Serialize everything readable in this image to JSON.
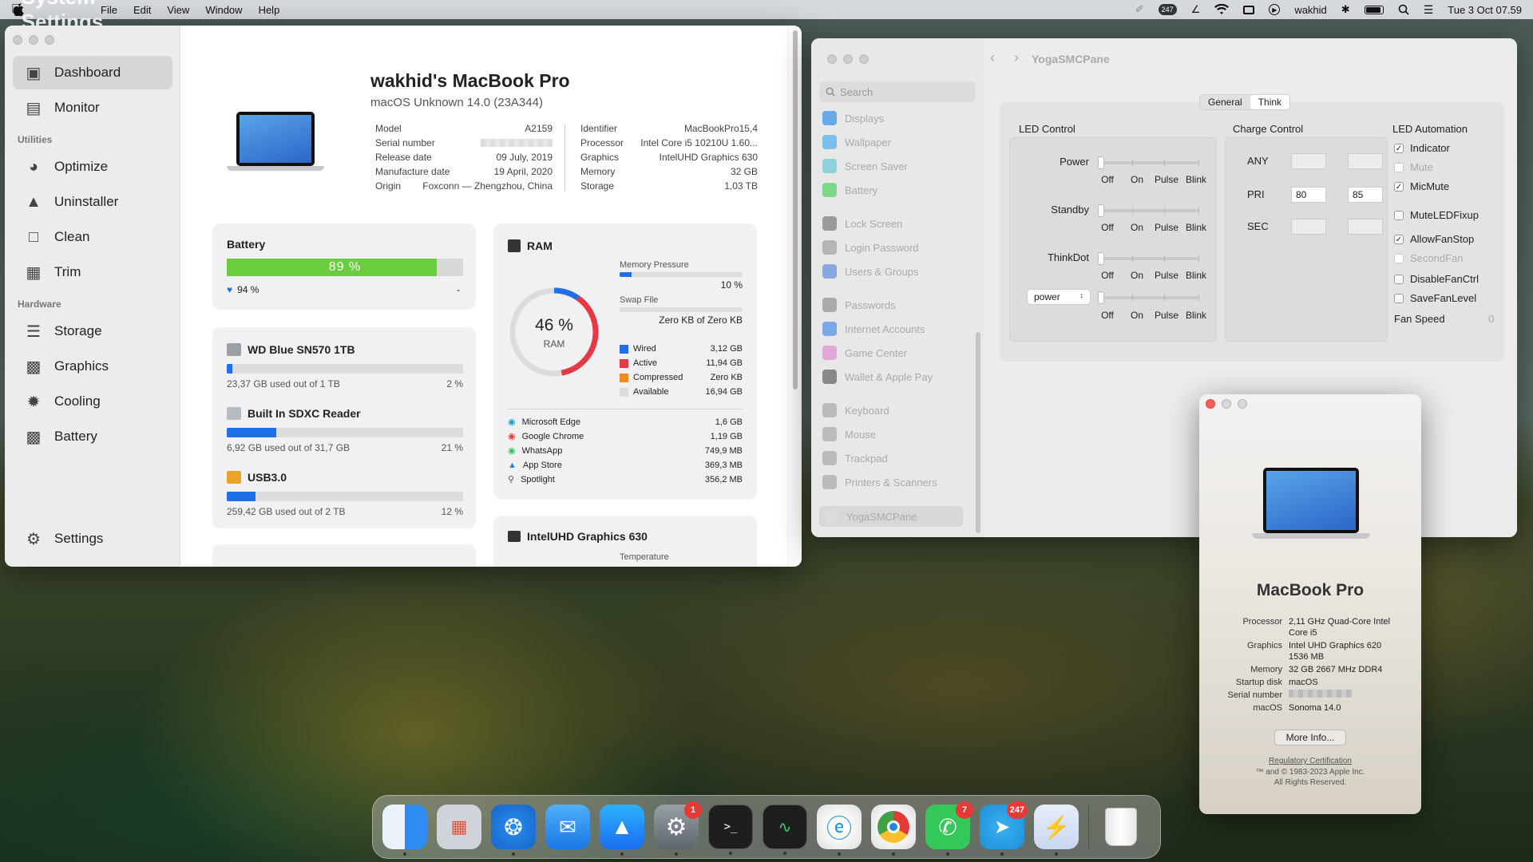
{
  "menubar": {
    "app": "System Settings",
    "items": [
      "File",
      "Edit",
      "View",
      "Window",
      "Help"
    ],
    "user": "wakhid",
    "clock": "Tue 3 Oct  07.59",
    "badge_247": "247"
  },
  "sidebar": {
    "items": [
      "Dashboard",
      "Monitor",
      "Optimize",
      "Uninstaller",
      "Clean",
      "Trim",
      "Storage",
      "Graphics",
      "Cooling",
      "Battery",
      "Settings"
    ],
    "utilities": "Utilities",
    "hardware": "Hardware"
  },
  "machine": {
    "name": "wakhid's MacBook Pro",
    "os": "macOS Unknown 14.0 (23A344)",
    "specs_left": [
      [
        "Model",
        "A2159"
      ],
      [
        "Serial number",
        ""
      ],
      [
        "Release date",
        "09 July, 2019"
      ],
      [
        "Manufacture date",
        "19 April, 2020"
      ],
      [
        "Origin",
        "Foxconn — Zhengzhou, China"
      ]
    ],
    "specs_right": [
      [
        "Identifier",
        "MacBookPro15,4"
      ],
      [
        "Processor",
        "Intel Core i5 10210U 1.60..."
      ],
      [
        "Graphics",
        "IntelUHD Graphics 630"
      ],
      [
        "Memory",
        "32 GB"
      ],
      [
        "Storage",
        "1,03 TB"
      ]
    ]
  },
  "battery": {
    "title": "Battery",
    "percent": "89 %",
    "level": 0.89,
    "health": "94 %",
    "dash": "-"
  },
  "disks": [
    {
      "name": "WD Blue SN570 1TB",
      "used": "23,37 GB used out of 1 TB",
      "pct": "2 %",
      "level": 0.02
    },
    {
      "name": "Built In SDXC Reader",
      "used": "6,92 GB used out of 31,7 GB",
      "pct": "21 %",
      "level": 0.21
    },
    {
      "name": "USB3.0",
      "used": "259,42 GB used out of 2 TB",
      "pct": "12 %",
      "level": 0.12
    }
  ],
  "ram": {
    "title": "RAM",
    "pct": "46 %",
    "label": "RAM",
    "level": 0.46,
    "pressure_label": "Memory Pressure",
    "pressure": "10 %",
    "pressure_level": 0.1,
    "swap_label": "Swap File",
    "swap": "Zero KB of Zero KB",
    "legend": [
      [
        "Wired",
        "3,12 GB",
        "#1f6fe8"
      ],
      [
        "Active",
        "11,94 GB",
        "#e53946"
      ],
      [
        "Compressed",
        "Zero KB",
        "#f08a24"
      ],
      [
        "Available",
        "16,94 GB",
        "#dcdcdc"
      ]
    ],
    "apps": [
      [
        "Microsoft Edge",
        "1,6 GB"
      ],
      [
        "Google Chrome",
        "1,19 GB"
      ],
      [
        "WhatsApp",
        "749,9 MB"
      ],
      [
        "App Store",
        "369,3 MB"
      ],
      [
        "Spotlight",
        "356,2 MB"
      ]
    ]
  },
  "gpu": {
    "title": "IntelUHD Graphics 630",
    "temp_label": "Temperature"
  },
  "settings_win": {
    "title": "YogaSMCPane",
    "search": "Search",
    "items": [
      "Displays",
      "Wallpaper",
      "Screen Saver",
      "Battery",
      "Lock Screen",
      "Login Password",
      "Users & Groups",
      "Passwords",
      "Internet Accounts",
      "Game Center",
      "Wallet & Apple Pay",
      "Keyboard",
      "Mouse",
      "Trackpad",
      "Printers & Scanners",
      "YogaSMCPane"
    ],
    "tabs": [
      "General",
      "Think"
    ],
    "led_control": "LED Control",
    "rows": [
      "Power",
      "Standby",
      "ThinkDot"
    ],
    "select_val": "power",
    "states": [
      "Off",
      "On",
      "Pulse",
      "Blink"
    ],
    "charge_control": "Charge Control",
    "charge": [
      [
        "ANY",
        "",
        ""
      ],
      [
        "PRI",
        "80",
        "85"
      ],
      [
        "SEC",
        "",
        ""
      ]
    ],
    "led_automation": "LED Automation",
    "checks": [
      [
        "Indicator",
        true,
        false
      ],
      [
        "Mute",
        false,
        true
      ],
      [
        "MicMute",
        true,
        false
      ],
      [
        "MuteLEDFixup",
        false,
        false
      ],
      [
        "AllowFanStop",
        true,
        false
      ],
      [
        "SecondFan",
        false,
        true
      ],
      [
        "DisableFanCtrl",
        false,
        false
      ],
      [
        "SaveFanLevel",
        false,
        false
      ]
    ],
    "fan_speed": "Fan Speed",
    "fan_val": "0"
  },
  "about": {
    "title": "MacBook Pro",
    "rows": [
      [
        "Processor",
        "2,11 GHz Quad-Core Intel Core i5"
      ],
      [
        "Graphics",
        "Intel UHD Graphics 620 1536 MB"
      ],
      [
        "Memory",
        "32 GB 2667 MHz DDR4"
      ],
      [
        "Startup disk",
        "macOS"
      ],
      [
        "Serial number",
        ""
      ],
      [
        "macOS",
        "Sonoma 14.0"
      ]
    ],
    "more": "More Info...",
    "reg": "Regulatory Certification",
    "copy1": "™ and © 1983-2023 Apple Inc.",
    "copy2": "All Rights Reserved."
  },
  "dock": {
    "badges": {
      "settings": "1",
      "whatsapp": "7",
      "telegram": "247"
    }
  }
}
